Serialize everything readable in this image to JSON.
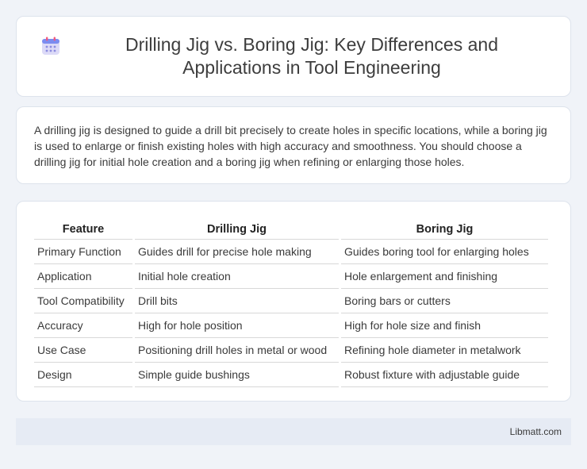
{
  "header": {
    "icon": "calendar-icon",
    "title": "Drilling Jig vs. Boring Jig: Key Differences and Applications in Tool Engineering"
  },
  "intro": {
    "text": "A drilling jig is designed to guide a drill bit precisely to create holes in specific locations, while a boring jig is used to enlarge or finish existing holes with high accuracy and smoothness. You should choose a drilling jig for initial hole creation and a boring jig when refining or enlarging those holes."
  },
  "table": {
    "headers": [
      "Feature",
      "Drilling Jig",
      "Boring Jig"
    ],
    "rows": [
      [
        "Primary Function",
        "Guides drill for precise hole making",
        "Guides boring tool for enlarging holes"
      ],
      [
        "Application",
        "Initial hole creation",
        "Hole enlargement and finishing"
      ],
      [
        "Tool Compatibility",
        "Drill bits",
        "Boring bars or cutters"
      ],
      [
        "Accuracy",
        "High for hole position",
        "High for hole size and finish"
      ],
      [
        "Use Case",
        "Positioning drill holes in metal or wood",
        "Refining hole diameter in metalwork"
      ],
      [
        "Design",
        "Simple guide bushings",
        "Robust fixture with adjustable guide"
      ]
    ]
  },
  "footer": {
    "text": "Libmatt.com"
  }
}
